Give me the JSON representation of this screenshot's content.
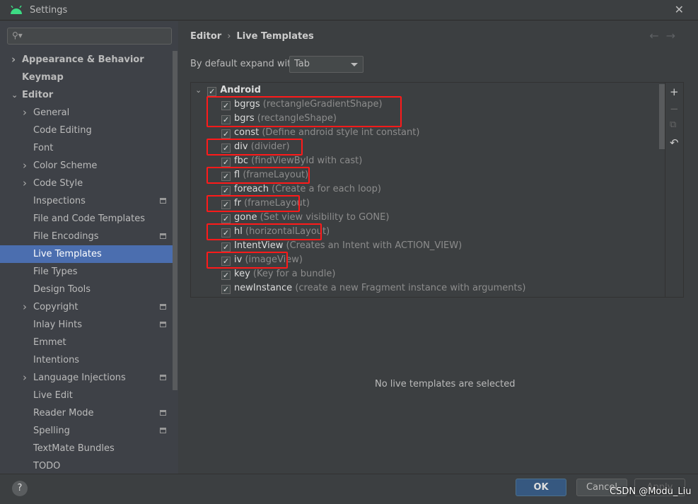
{
  "window": {
    "title": "Settings",
    "close": "✕"
  },
  "sidebar": {
    "search_placeholder": "",
    "items": [
      {
        "label": "Appearance & Behavior",
        "level": 0,
        "chevron": "right",
        "bold": true
      },
      {
        "label": "Keymap",
        "level": 0,
        "bold": true
      },
      {
        "label": "Editor",
        "level": 0,
        "chevron": "down",
        "bold": true
      },
      {
        "label": "General",
        "level": 1,
        "chevron": "right"
      },
      {
        "label": "Code Editing",
        "level": 1
      },
      {
        "label": "Font",
        "level": 1
      },
      {
        "label": "Color Scheme",
        "level": 1,
        "chevron": "right"
      },
      {
        "label": "Code Style",
        "level": 1,
        "chevron": "right"
      },
      {
        "label": "Inspections",
        "level": 1,
        "gear": true
      },
      {
        "label": "File and Code Templates",
        "level": 1
      },
      {
        "label": "File Encodings",
        "level": 1,
        "gear": true
      },
      {
        "label": "Live Templates",
        "level": 1,
        "selected": true
      },
      {
        "label": "File Types",
        "level": 1
      },
      {
        "label": "Design Tools",
        "level": 1
      },
      {
        "label": "Copyright",
        "level": 1,
        "chevron": "right",
        "gear": true
      },
      {
        "label": "Inlay Hints",
        "level": 1,
        "gear": true
      },
      {
        "label": "Emmet",
        "level": 1
      },
      {
        "label": "Intentions",
        "level": 1
      },
      {
        "label": "Language Injections",
        "level": 1,
        "chevron": "right",
        "gear": true
      },
      {
        "label": "Live Edit",
        "level": 1
      },
      {
        "label": "Reader Mode",
        "level": 1,
        "gear": true
      },
      {
        "label": "Spelling",
        "level": 1,
        "gear": true
      },
      {
        "label": "TextMate Bundles",
        "level": 1
      },
      {
        "label": "TODO",
        "level": 1
      }
    ]
  },
  "breadcrumb": {
    "parent": "Editor",
    "sep": "›",
    "current": "Live Templates"
  },
  "expand": {
    "label": "By default expand with",
    "value": "Tab"
  },
  "templates": {
    "group": "Android",
    "items": [
      {
        "abbr": "bgrgs",
        "desc": "(rectangleGradientShape)",
        "checked": true
      },
      {
        "abbr": "bgrs",
        "desc": "(rectangleShape)",
        "checked": true
      },
      {
        "abbr": "const",
        "desc": "(Define android style int constant)",
        "checked": true
      },
      {
        "abbr": "div",
        "desc": "(divider)",
        "checked": true
      },
      {
        "abbr": "fbc",
        "desc": "(findViewById with cast)",
        "checked": true
      },
      {
        "abbr": "fl",
        "desc": "(frameLayout)",
        "checked": true
      },
      {
        "abbr": "foreach",
        "desc": "(Create a for each loop)",
        "checked": true
      },
      {
        "abbr": "fr",
        "desc": "(frameLayout)",
        "checked": true
      },
      {
        "abbr": "gone",
        "desc": "(Set view visibility to GONE)",
        "checked": true
      },
      {
        "abbr": "hl",
        "desc": "(horizontalLayout)",
        "checked": true
      },
      {
        "abbr": "IntentView",
        "desc": "(Creates an Intent with ACTION_VIEW)",
        "checked": true
      },
      {
        "abbr": "iv",
        "desc": "(imageView)",
        "checked": true
      },
      {
        "abbr": "key",
        "desc": "(Key for a bundle)",
        "checked": true
      },
      {
        "abbr": "newInstance",
        "desc": "(create a new Fragment instance with arguments)",
        "checked": true
      }
    ]
  },
  "empty_text": "No live templates are selected",
  "footer": {
    "help": "?",
    "ok": "OK",
    "cancel": "Cancel",
    "apply": "Apply"
  },
  "watermark": "CSDN @Modu_Liu",
  "colors": {
    "selection": "#4b6eaf",
    "ok": "#365880",
    "highlight": "#ff1a1a",
    "android": "#3ddc84"
  }
}
